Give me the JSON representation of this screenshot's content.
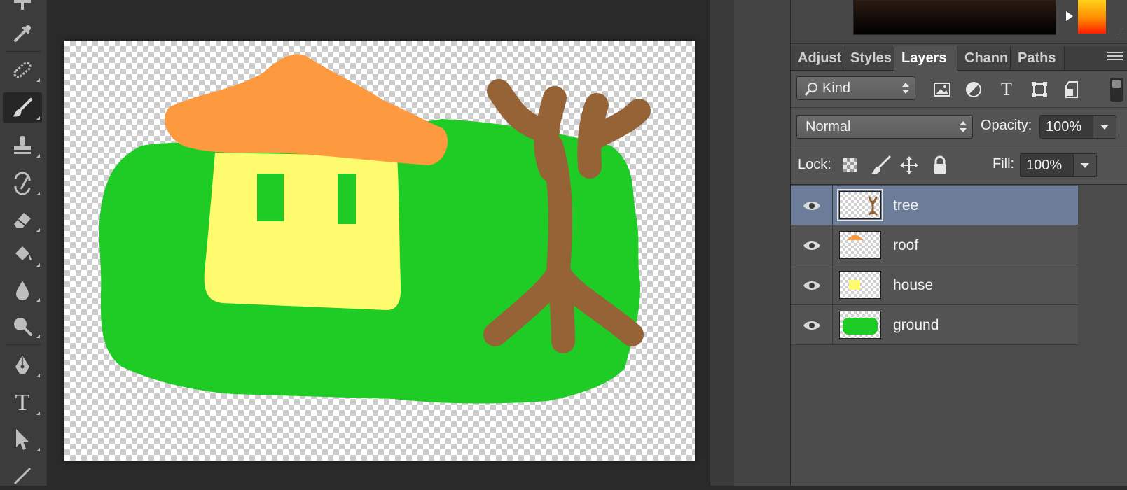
{
  "toolbar": {
    "tools": [
      {
        "name": "add-icon",
        "active": false
      },
      {
        "name": "eyedropper-icon",
        "active": false
      },
      {
        "name": "healing-brush-icon",
        "active": false
      },
      {
        "name": "brush-icon",
        "active": true
      },
      {
        "name": "clone-stamp-icon",
        "active": false
      },
      {
        "name": "history-brush-icon",
        "active": false
      },
      {
        "name": "eraser-icon",
        "active": false
      },
      {
        "name": "paint-bucket-icon",
        "active": false
      },
      {
        "name": "blur-icon",
        "active": false
      },
      {
        "name": "dodge-icon",
        "active": false
      },
      {
        "name": "pen-icon",
        "active": false
      },
      {
        "name": "type-icon",
        "active": false
      },
      {
        "name": "path-selection-icon",
        "active": false
      },
      {
        "name": "line-icon",
        "active": false
      }
    ],
    "type_glyph": "T"
  },
  "canvas": {
    "colors": {
      "ground": "#1fcc26",
      "house": "#fefb6e",
      "windows": "#1fcc26",
      "roof": "#fd9a40",
      "tree": "#956336"
    }
  },
  "color_panel": {
    "hue_top": "#ffd21a",
    "hue_bottom": "#ff1d00"
  },
  "layers_panel": {
    "tabs": [
      {
        "label": "Adjust",
        "active": false
      },
      {
        "label": "Styles",
        "active": false
      },
      {
        "label": "Layers",
        "active": true
      },
      {
        "label": "Chann",
        "active": false
      },
      {
        "label": "Paths",
        "active": false
      }
    ],
    "filter_value": "Kind",
    "filter_icons": [
      "image-filter-icon",
      "adjustment-filter-icon",
      "type-filter-icon",
      "shape-filter-icon",
      "smart-object-filter-icon"
    ],
    "blend_mode": "Normal",
    "opacity_label": "Opacity:",
    "opacity_value": "100%",
    "lock_label": "Lock:",
    "lock_icons": [
      "lock-transparent-icon",
      "lock-image-icon",
      "lock-position-icon",
      "lock-all-icon"
    ],
    "fill_label": "Fill:",
    "fill_value": "100%",
    "layers": [
      {
        "name": "tree",
        "selected": true,
        "visible": true
      },
      {
        "name": "roof",
        "selected": false,
        "visible": true
      },
      {
        "name": "house",
        "selected": false,
        "visible": true
      },
      {
        "name": "ground",
        "selected": false,
        "visible": true
      }
    ],
    "selected_color": "#6b7d99"
  }
}
